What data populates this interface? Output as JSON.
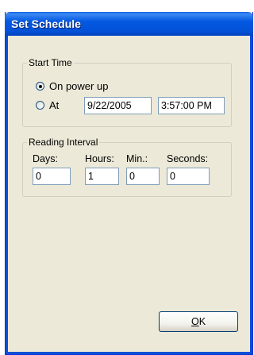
{
  "window": {
    "title": "Set Schedule"
  },
  "start_time": {
    "legend": "Start Time",
    "options": [
      {
        "label": "On power up",
        "checked": true
      },
      {
        "label": "At",
        "checked": false
      }
    ],
    "date_value": "9/22/2005",
    "time_value": "3:57:00 PM"
  },
  "reading_interval": {
    "legend": "Reading Interval",
    "fields": [
      {
        "label": "Days:",
        "value": "0"
      },
      {
        "label": "Hours:",
        "value": "1"
      },
      {
        "label": "Min.:",
        "value": "0"
      },
      {
        "label": "Seconds:",
        "value": "0"
      }
    ]
  },
  "buttons": {
    "ok_mnemonic": "O",
    "ok_rest": "K"
  }
}
